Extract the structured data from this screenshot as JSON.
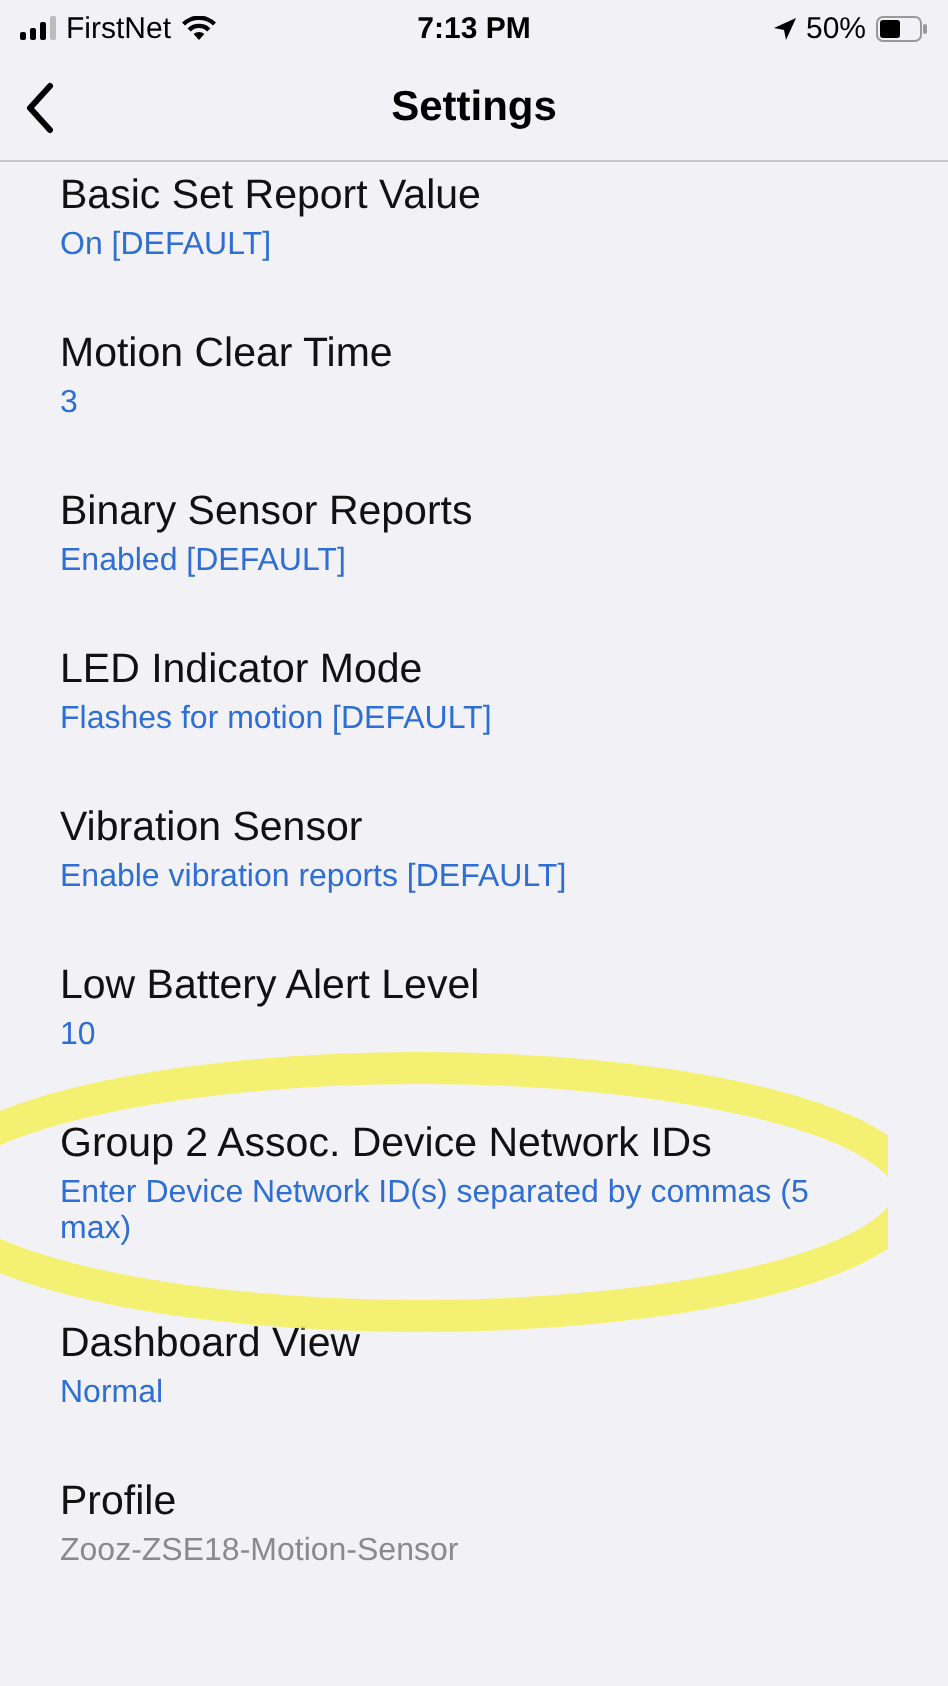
{
  "status_bar": {
    "carrier": "FirstNet",
    "time": "7:13 PM",
    "battery": "50%"
  },
  "nav": {
    "title": "Settings"
  },
  "settings": [
    {
      "title": "Basic Set Report Value",
      "value": "On [DEFAULT]",
      "readonly": false
    },
    {
      "title": "Motion Clear Time",
      "value": "3",
      "readonly": false
    },
    {
      "title": "Binary Sensor Reports",
      "value": "Enabled [DEFAULT]",
      "readonly": false
    },
    {
      "title": "LED Indicator Mode",
      "value": "Flashes for motion [DEFAULT]",
      "readonly": false
    },
    {
      "title": "Vibration Sensor",
      "value": "Enable vibration reports [DEFAULT]",
      "readonly": false
    },
    {
      "title": "Low Battery Alert Level",
      "value": "10",
      "readonly": false
    },
    {
      "title": "Group 2 Assoc. Device Network IDs",
      "value": "Enter Device Network ID(s) separated by commas (5 max)",
      "readonly": false
    },
    {
      "title": "Dashboard View",
      "value": "Normal",
      "readonly": false
    },
    {
      "title": "Profile",
      "value": "Zooz-ZSE18-Motion-Sensor",
      "readonly": true
    }
  ]
}
